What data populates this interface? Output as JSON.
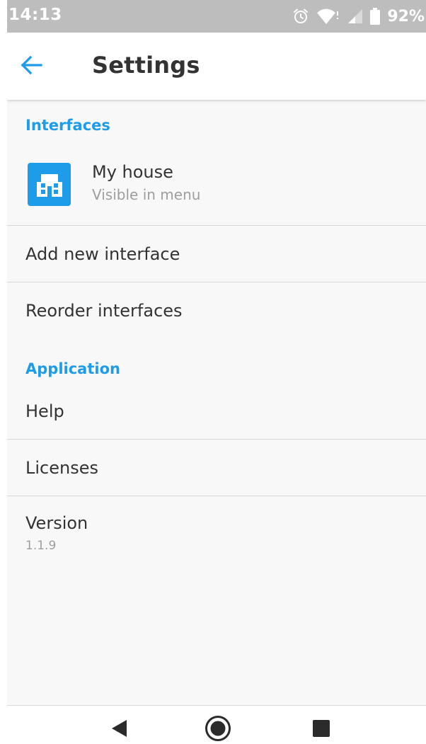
{
  "status_bar": {
    "time": "14:13",
    "battery": "92%",
    "icons": [
      "alarm-icon",
      "wifi-icon",
      "signal-icon",
      "battery-icon"
    ]
  },
  "app_bar": {
    "title": "Settings",
    "back_icon": "arrow-back-icon"
  },
  "sections": {
    "interfaces": {
      "header": "Interfaces",
      "house": {
        "name": "My house",
        "subtitle": "Visible in menu",
        "icon": "house-icon"
      },
      "add_label": "Add new interface",
      "reorder_label": "Reorder interfaces"
    },
    "application": {
      "header": "Application",
      "help_label": "Help",
      "licenses_label": "Licenses",
      "version_label": "Version",
      "version_value": "1.1.9"
    }
  },
  "nav_bar": {
    "icons": [
      "back-triangle-icon",
      "home-circle-icon",
      "recents-square-icon"
    ]
  },
  "colors": {
    "accent": "#1e9be9",
    "status_bar_bg": "#bdbdbd",
    "text_primary": "#333333",
    "text_secondary": "#9e9e9e",
    "divider": "#d8d8d8"
  }
}
